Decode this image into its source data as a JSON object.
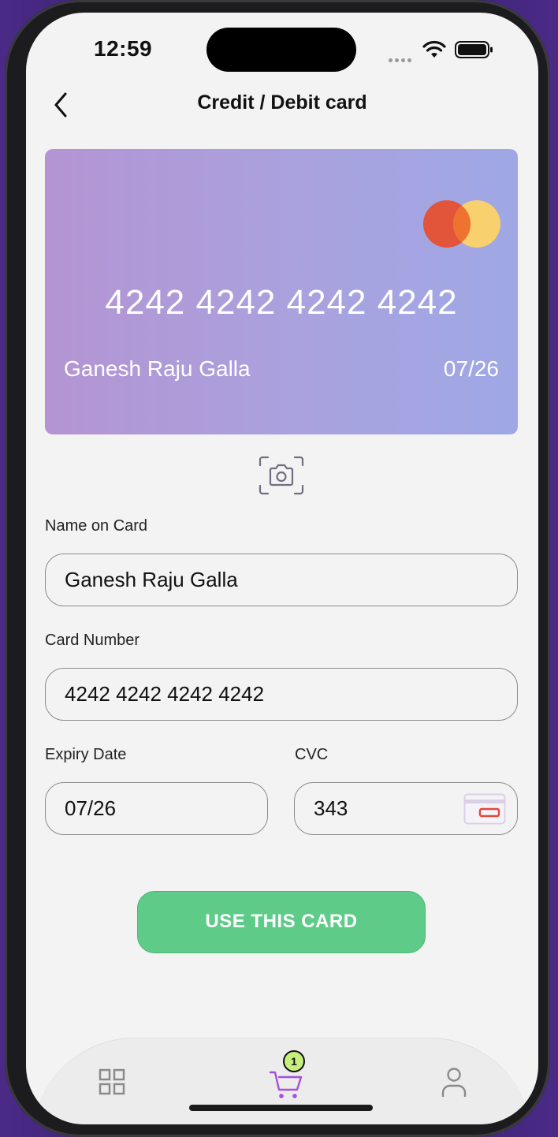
{
  "status_bar": {
    "time": "12:59"
  },
  "header": {
    "title": "Credit / Debit card"
  },
  "card_preview": {
    "number": "4242 4242 4242 4242",
    "holder": "Ganesh Raju Galla",
    "expiry": "07/26",
    "brand_icon": "mastercard-logo",
    "gradient_start": "#b494d3",
    "gradient_end": "#9fa8e5"
  },
  "scan_icon": "camera-scan-icon",
  "form": {
    "name_label": "Name on Card",
    "name_value": "Ganesh Raju Galla",
    "number_label": "Card Number",
    "number_value": "4242 4242 4242 4242",
    "expiry_label": "Expiry Date",
    "expiry_value": "07/26",
    "cvc_label": "CVC",
    "cvc_value": "343"
  },
  "submit": {
    "label": "USE THIS CARD",
    "color": "#5ecc88"
  },
  "tab_bar": {
    "items": [
      {
        "icon": "grid-icon"
      },
      {
        "icon": "cart-icon",
        "badge": "1",
        "active_color": "#a64ee0"
      },
      {
        "icon": "user-icon"
      }
    ]
  }
}
